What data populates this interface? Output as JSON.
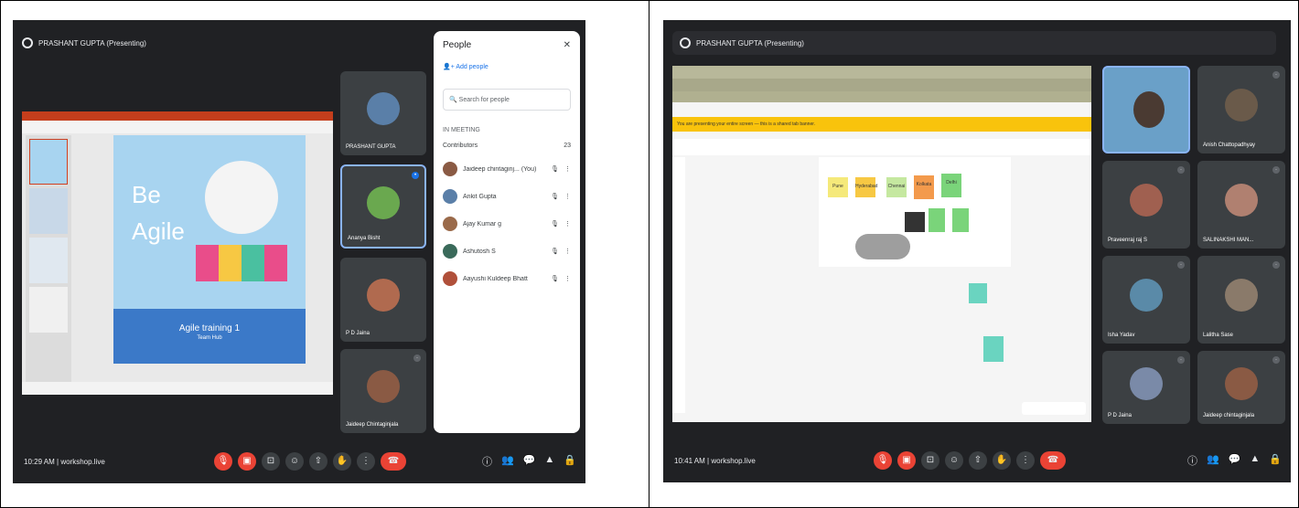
{
  "left": {
    "presenting_label": "PRASHANT GUPTA (Presenting)",
    "slide": {
      "title_line1": "Be",
      "title_line2": "Agile",
      "footer_title": "Agile training 1",
      "footer_sub": "Team Hub"
    },
    "tiles": [
      {
        "name": "PRASHANT GUPTA",
        "color": "#5a7fa8"
      },
      {
        "name": "Ananya Bisht",
        "color": "#6aa84f"
      },
      {
        "name": "P D Jaina",
        "color": "#b06a4f"
      },
      {
        "name": "Jaideep Chintaginjala",
        "color": "#8a5a44"
      }
    ],
    "people": {
      "title": "People",
      "add_label": "Add people",
      "search_placeholder": "Search for people",
      "section": "IN MEETING",
      "contributors_label": "Contributors",
      "contributors_count": "23",
      "rows": [
        {
          "name": "Jaideep chintaginj... (You)",
          "color": "#8a5a44"
        },
        {
          "name": "Ankit Gupta",
          "color": "#5a7fa8"
        },
        {
          "name": "Ajay Kumar g",
          "color": "#9a6a4a"
        },
        {
          "name": "Ashutosh S",
          "color": "#3a6a5a"
        },
        {
          "name": "Aayushi Kuldeep Bhatt",
          "color": "#b0503a"
        }
      ]
    },
    "time": "10:29 AM",
    "meeting": "workshop.live",
    "colors": {
      "meet_bg": "#202124",
      "red": "#ea4335",
      "blue": "#1a73e8"
    }
  },
  "right": {
    "presenting_label": "PRASHANT GUPTA (Presenting)",
    "banner": "You are presenting your entire screen — this is a shared tab banner.",
    "tiles": [
      {
        "name": "Anish Chattopadhyay",
        "color": "#6a5a4a"
      },
      {
        "name": "Praveenraj raj S",
        "color": "#a06050"
      },
      {
        "name": "SALINAKSHI MAN...",
        "color": "#b08070"
      },
      {
        "name": "Isha Yadav",
        "color": "#5a8aa8"
      },
      {
        "name": "Lalitha Sase",
        "color": "#8a7a6a"
      },
      {
        "name": "P D Jaina",
        "color": "#7a8aa8"
      },
      {
        "name": "Jaideep chintaginjala",
        "color": "#8a5a44"
      }
    ],
    "stickies": [
      "Pune",
      "Hyderabad",
      "Chennai",
      "Kolkata",
      "Delhi",
      "",
      "",
      "",
      ""
    ],
    "time": "10:41 AM",
    "meeting": "workshop.live"
  }
}
